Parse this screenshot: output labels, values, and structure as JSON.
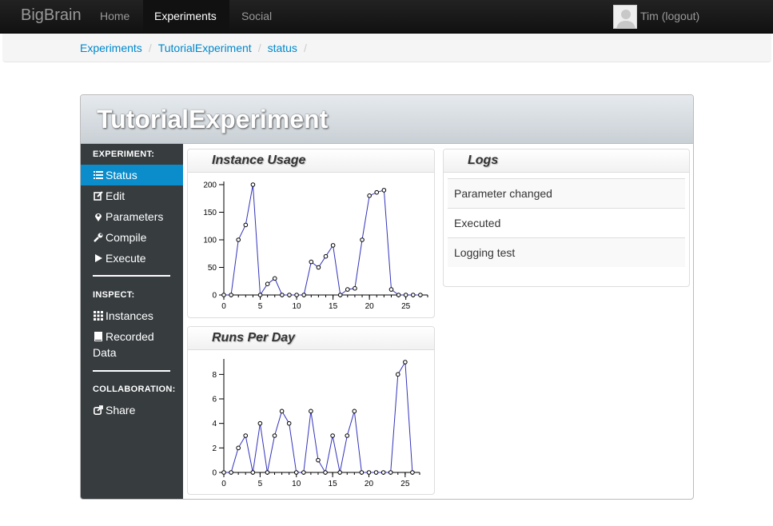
{
  "navbar": {
    "brand": "BigBrain",
    "items": [
      {
        "label": "Home",
        "active": false
      },
      {
        "label": "Experiments",
        "active": true
      },
      {
        "label": "Social",
        "active": false
      }
    ],
    "user": "Tim (logout)"
  },
  "breadcrumb": [
    "Experiments",
    "TutorialExperiment",
    "status"
  ],
  "panel": {
    "title": "TutorialExperiment"
  },
  "sidebar": {
    "sections": [
      {
        "title": "EXPERIMENT:",
        "items": [
          {
            "label": "Status",
            "icon": "list-icon",
            "active": true
          },
          {
            "label": "Edit",
            "icon": "edit-icon",
            "active": false
          },
          {
            "label": "Parameters",
            "icon": "map-marker-icon",
            "active": false
          },
          {
            "label": "Compile",
            "icon": "wrench-icon",
            "active": false
          },
          {
            "label": "Execute",
            "icon": "play-icon",
            "active": false
          }
        ]
      },
      {
        "title": "INSPECT:",
        "items": [
          {
            "label": "Instances",
            "icon": "grid-icon",
            "active": false
          },
          {
            "label_line1": "Recorded",
            "label_line2": "Data",
            "icon": "book-icon",
            "active": false
          }
        ]
      },
      {
        "title": "COLLABORATION:",
        "items": [
          {
            "label": "Share",
            "icon": "share-icon",
            "active": false
          }
        ]
      }
    ]
  },
  "logs": {
    "title": "Logs",
    "entries": [
      "Parameter changed",
      "Executed",
      "Logging test"
    ]
  },
  "colors": {
    "line": "#3333bb",
    "active": "#0b8ccb",
    "link": "#0088cc"
  },
  "chart_data": [
    {
      "type": "line",
      "title": "Instance Usage",
      "x": [
        0,
        1,
        2,
        3,
        4,
        5,
        6,
        7,
        8,
        9,
        10,
        11,
        12,
        13,
        14,
        15,
        16,
        17,
        18,
        19,
        20,
        21,
        22,
        23,
        24,
        25,
        26,
        27
      ],
      "y": [
        0,
        0,
        100,
        127,
        200,
        0,
        20,
        30,
        0,
        0,
        0,
        0,
        60,
        50,
        70,
        90,
        0,
        10,
        12,
        100,
        180,
        186,
        190,
        10,
        0,
        0,
        0,
        0
      ],
      "xlim": [
        0,
        28
      ],
      "ylim": [
        0,
        200
      ],
      "xticks": [
        0,
        5,
        10,
        15,
        20,
        25
      ],
      "yticks": [
        0,
        50,
        100,
        150,
        200
      ]
    },
    {
      "type": "line",
      "title": "Runs Per Day",
      "x": [
        0,
        1,
        2,
        3,
        4,
        5,
        6,
        7,
        8,
        9,
        10,
        11,
        12,
        13,
        14,
        15,
        16,
        17,
        18,
        19,
        20,
        21,
        22,
        23,
        24,
        25,
        26
      ],
      "y": [
        0,
        0,
        2,
        3,
        0,
        4,
        0,
        3,
        5,
        4,
        0,
        0,
        5,
        1,
        0,
        3,
        0,
        3,
        5,
        0,
        0,
        0,
        0,
        0,
        8,
        9,
        0
      ],
      "xlim": [
        0,
        27
      ],
      "ylim": [
        0,
        9
      ],
      "xticks": [
        0,
        5,
        10,
        15,
        20,
        25
      ],
      "yticks": [
        0,
        2,
        4,
        6,
        8
      ]
    }
  ]
}
